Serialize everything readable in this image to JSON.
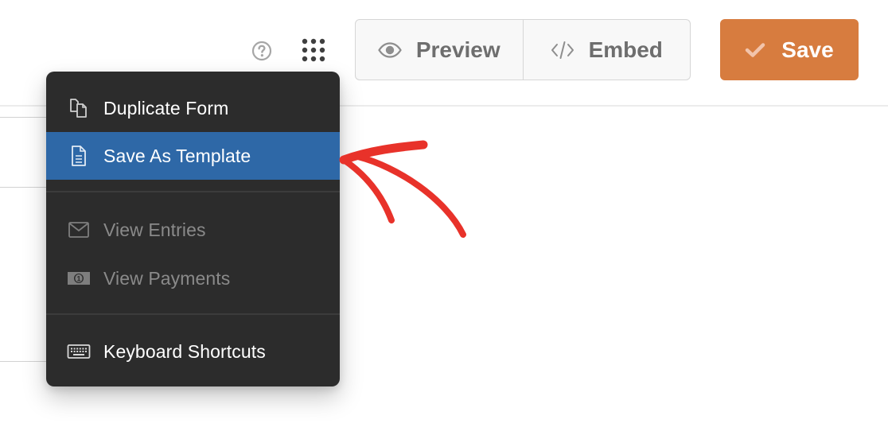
{
  "header": {
    "help_icon": "question-circle-icon",
    "apps_icon": "grid-dots-icon",
    "preview_label": "Preview",
    "embed_label": "Embed",
    "save_label": "Save"
  },
  "menu": {
    "items": [
      {
        "label": "Duplicate Form",
        "icon": "duplicate-icon",
        "state": "normal"
      },
      {
        "label": "Save As Template",
        "icon": "document-icon",
        "state": "highlighted"
      },
      {
        "label": "View Entries",
        "icon": "envelope-icon",
        "state": "disabled"
      },
      {
        "label": "View Payments",
        "icon": "money-icon",
        "state": "disabled"
      },
      {
        "label": "Keyboard Shortcuts",
        "icon": "keyboard-icon",
        "state": "normal"
      }
    ]
  },
  "colors": {
    "save_button": "#d77c3f",
    "menu_background": "#2c2c2c",
    "menu_highlight": "#2e68a7",
    "annotation_arrow": "#e8322a"
  }
}
